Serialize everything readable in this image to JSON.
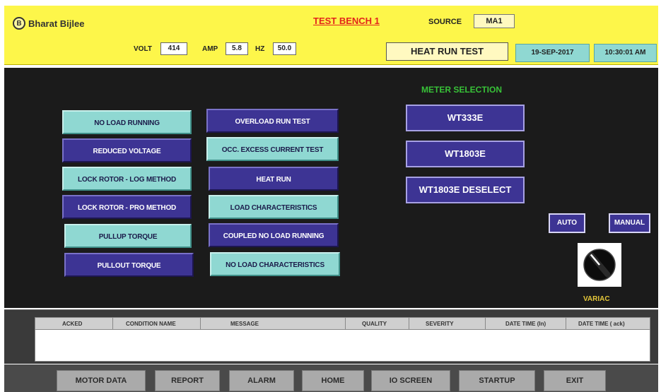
{
  "header": {
    "logo_letter": "B",
    "company": "Bharat Bijlee",
    "bench_title": "TEST BENCH 1",
    "source_label": "SOURCE",
    "source_value": "MA1",
    "volt_label": "VOLT",
    "volt_value": "414",
    "amp_label": "AMP",
    "amp_value": "5.8",
    "hz_label": "HZ",
    "hz_value": "50.0",
    "test_name": "HEAT RUN TEST",
    "date": "19-SEP-2017",
    "time": "10:30:01 AM"
  },
  "tests": {
    "left": [
      "NO LOAD RUNNING",
      "REDUCED VOLTAGE",
      "LOCK ROTOR - LOG METHOD",
      "LOCK ROTOR - PRO METHOD",
      "PULLUP TORQUE",
      "PULLOUT TORQUE"
    ],
    "right": [
      "OVERLOAD RUN TEST",
      "OCC. EXCESS CURRENT TEST",
      "HEAT RUN",
      "LOAD CHARACTERISTICS",
      "COUPLED NO LOAD RUNNING",
      "NO LOAD CHARACTERISTICS"
    ]
  },
  "meter": {
    "title": "METER SELECTION",
    "options": [
      "WT333E",
      "WT1803E",
      "WT1803E DESELECT"
    ]
  },
  "mode": {
    "auto": "AUTO",
    "manual": "MANUAL"
  },
  "variac": {
    "label": "VARIAC"
  },
  "alarm": {
    "columns": [
      "ACKED",
      "CONDITION NAME",
      "MESSAGE",
      "QUALITY",
      "SEVERITY",
      "DATE TIME (In)",
      "DATE TIME ( ack)"
    ]
  },
  "nav": [
    "MOTOR DATA",
    "REPORT",
    "ALARM",
    "HOME",
    "IO SCREEN",
    "STARTUP",
    "EXIT"
  ],
  "colors": {
    "header_bg": "#fdf64a",
    "panel_bg": "#1b1b1b",
    "button_cyan": "#8fd8d2",
    "button_purple": "#3d3494",
    "title_red": "#e3241b",
    "meter_title_green": "#38c238",
    "variac_label": "#e6c83a"
  }
}
